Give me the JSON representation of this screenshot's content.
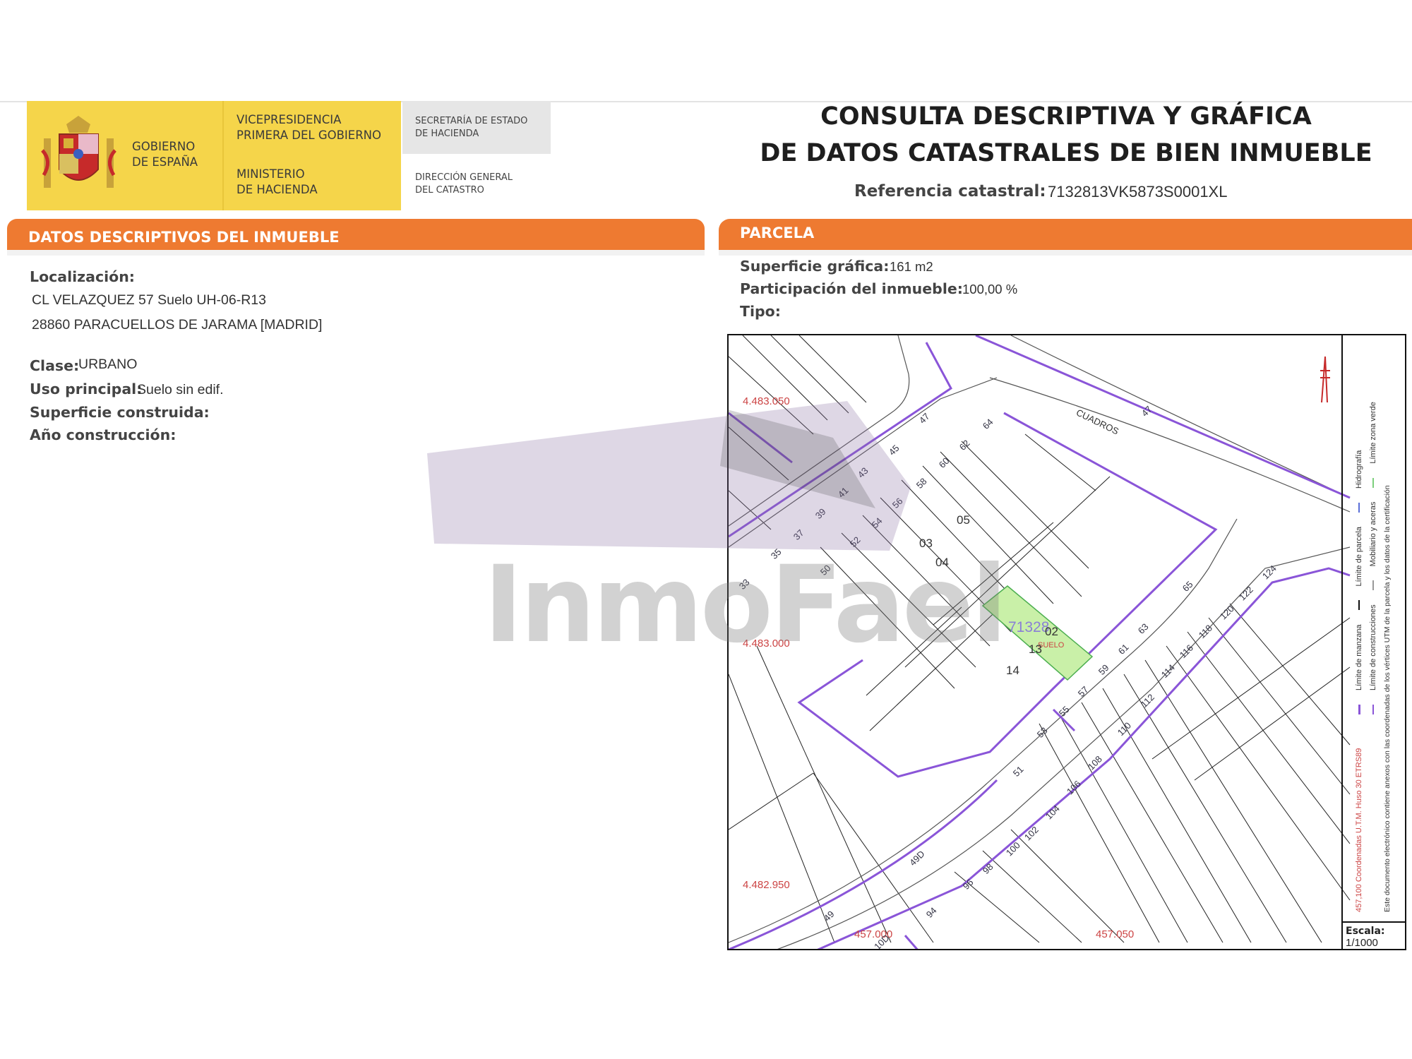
{
  "header": {
    "gobierno": [
      "GOBIERNO",
      "DE ESPAÑA"
    ],
    "vicepresidencia": [
      "VICEPRESIDENCIA",
      "PRIMERA DEL GOBIERNO"
    ],
    "ministerio": [
      "MINISTERIO",
      "DE HACIENDA"
    ],
    "secretaria": [
      "SECRETARÍA DE ESTADO",
      "DE HACIENDA"
    ],
    "direccion": [
      "DIRECCIÓN GENERAL",
      "DEL CATASTRO"
    ],
    "title_line1": "CONSULTA DESCRIPTIVA Y GRÁFICA",
    "title_line2": "DE DATOS CATASTRALES DE BIEN INMUEBLE",
    "ref_label": "Referencia catastral:",
    "ref_value": "7132813VK5873S0001XL"
  },
  "colors": {
    "orange": "#ee7a31",
    "yellow": "#f5d54a",
    "manzana": "#8a55d8",
    "parcel_fill": "#c9f0a8"
  },
  "left_panel": {
    "title": "DATOS DESCRIPTIVOS DEL INMUEBLE",
    "localizacion_label": "Localización:",
    "address_line1": "CL VELAZQUEZ 57 Suelo UH-06-R13",
    "address_line2": "28860 PARACUELLOS DE JARAMA [MADRID]",
    "clase_label": "Clase:",
    "clase_value": "URBANO",
    "uso_label": "Uso principal:",
    "uso_value": "Suelo sin edif.",
    "superficie_label": "Superficie construida:",
    "anio_label": "Año construcción:"
  },
  "right_panel": {
    "title": "PARCELA",
    "superficie_label": "Superficie gráfica:",
    "superficie_value": "161 m2",
    "participacion_label": "Participación del inmueble:",
    "participacion_value": "100,00 %",
    "tipo_label": "Tipo:"
  },
  "map": {
    "coords": [
      "4.483.050",
      "4.483.000",
      "4.482.950",
      "457.000",
      "457.050"
    ],
    "street": "CUADROS",
    "parcel_ref": "71328",
    "parcel_num": "02",
    "parcel_suelo": "SUELO",
    "lot_numbers": [
      "03",
      "04",
      "05",
      "13",
      "14"
    ],
    "house_numbers": [
      "47",
      "45",
      "43",
      "41",
      "39",
      "37",
      "35",
      "33",
      "64",
      "62",
      "60",
      "58",
      "56",
      "54",
      "52",
      "50",
      "47",
      "65",
      "63",
      "61",
      "59",
      "57",
      "55",
      "53",
      "51",
      "49D",
      "49",
      "124",
      "122",
      "120",
      "118",
      "116",
      "114",
      "112",
      "110",
      "108",
      "106",
      "104",
      "102",
      "100",
      "98",
      "96",
      "94",
      "10D"
    ],
    "legend": {
      "col1": [
        "Límite de manzana",
        "Límite de parcela",
        "Hidrografía"
      ],
      "col2": [
        "Límite de construcciones",
        "Mobiliario y aceras",
        "Límite zona verde"
      ],
      "col3a": "457,100 Coordenadas U.T.M. Huso 30 ETRS89",
      "col3b": "Este documento electrónico contiene anexos con las coordenadas de los vértices UTM de la parcela y los datos de la certificación"
    },
    "scale_label": "Escala:",
    "scale_value": "1/1000"
  },
  "watermark": {
    "text": "InmoFael"
  }
}
